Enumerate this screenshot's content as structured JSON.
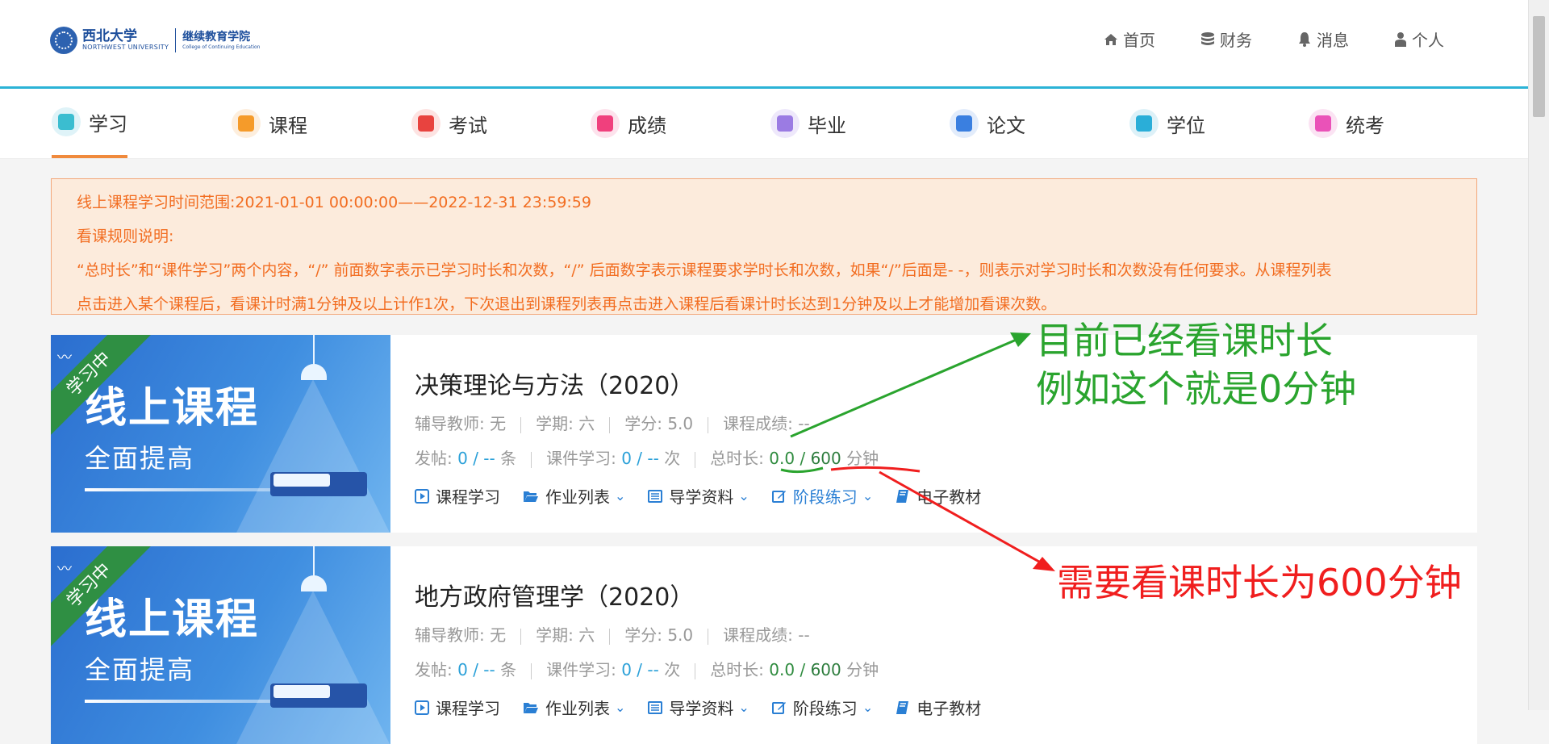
{
  "header": {
    "logo": {
      "cn_name": "西北大学",
      "en_name": "NORTHWEST UNIVERSITY",
      "college_cn": "继续教育学院",
      "college_en": "College of Continuing Education"
    },
    "nav": [
      {
        "label": "首页",
        "icon": "home-icon"
      },
      {
        "label": "财务",
        "icon": "database-icon"
      },
      {
        "label": "消息",
        "icon": "bell-icon"
      },
      {
        "label": "个人",
        "icon": "user-icon"
      }
    ]
  },
  "main_nav": {
    "active": "学习",
    "items": [
      {
        "label": "学习",
        "icon": "study-icon",
        "color": "#3bbdd0",
        "bg": "#dff3f8"
      },
      {
        "label": "课程",
        "icon": "bookmark-icon",
        "color": "#f59b2a",
        "bg": "#fdeedd"
      },
      {
        "label": "考试",
        "icon": "pen-icon",
        "color": "#e8433f",
        "bg": "#fde3e2"
      },
      {
        "label": "成绩",
        "icon": "score-100-icon",
        "color": "#f0407d",
        "bg": "#fde2ec"
      },
      {
        "label": "毕业",
        "icon": "certificate-icon",
        "color": "#9b7be3",
        "bg": "#eee8fb"
      },
      {
        "label": "论文",
        "icon": "document-icon",
        "color": "#3a7fe0",
        "bg": "#e2ecfb"
      },
      {
        "label": "学位",
        "icon": "graduation-cap-icon",
        "color": "#2aaed8",
        "bg": "#ddf1f8"
      },
      {
        "label": "统考",
        "icon": "folder-icon",
        "color": "#ea52b8",
        "bg": "#fbe3f3"
      }
    ]
  },
  "notice": {
    "line1": "线上课程学习时间范围:2021-01-01 00:00:00——2022-12-31 23:59:59",
    "line2": "看课规则说明:",
    "line3": "“总时长”和“课件学习”两个内容，“/” 前面数字表示已学习时长和次数，“/” 后面数字表示课程要求学时长和次数，如果“/”后面是- -，则表示对学习时长和次数没有任何要求。从课程列表",
    "line4": "点击进入某个课程后，看课计时满1分钟及以上计作1次，下次退出到课程列表再点击进入课程后看课计时长达到1分钟及以上才能增加看课次数。"
  },
  "banner": {
    "ribbon": "学习中",
    "title": "线上课程",
    "subtitle": "全面提高",
    "wave": "〰"
  },
  "labels": {
    "tutor": "辅导教师:",
    "term": "学期:",
    "credit": "学分:",
    "grade": "课程成绩:",
    "posts": "发帖:",
    "posts_unit": "条",
    "courseware": "课件学习:",
    "courseware_unit": "次",
    "duration": "总时长:",
    "duration_unit": "分钟",
    "slash": " / "
  },
  "courses": [
    {
      "title": "决策理论与方法（2020）",
      "tutor": "无",
      "term": "六",
      "credit": "5.0",
      "grade": "--",
      "posts_done": "0",
      "posts_req": "--",
      "cw_done": "0",
      "cw_req": "--",
      "dur_done": "0.0",
      "dur_req": "600"
    },
    {
      "title": "地方政府管理学（2020）",
      "tutor": "无",
      "term": "六",
      "credit": "5.0",
      "grade": "--",
      "posts_done": "0",
      "posts_req": "--",
      "cw_done": "0",
      "cw_req": "--",
      "dur_done": "0.0",
      "dur_req": "600"
    }
  ],
  "actions": [
    {
      "label": "课程学习",
      "icon": "play-square-icon",
      "dropdown": false
    },
    {
      "label": "作业列表",
      "icon": "folder-open-icon",
      "dropdown": true
    },
    {
      "label": "导学资料",
      "icon": "list-icon",
      "dropdown": true
    },
    {
      "label": "阶段练习",
      "icon": "edit-icon",
      "dropdown": true
    },
    {
      "label": "电子教材",
      "icon": "book-icon",
      "dropdown": false
    }
  ],
  "annotations": {
    "green_line1": "目前已经看课时长",
    "green_line2": "例如这个就是0分钟",
    "red": "需要看课时长为600分钟",
    "green_color": "#2aa42e",
    "red_color": "#f01e1e"
  }
}
